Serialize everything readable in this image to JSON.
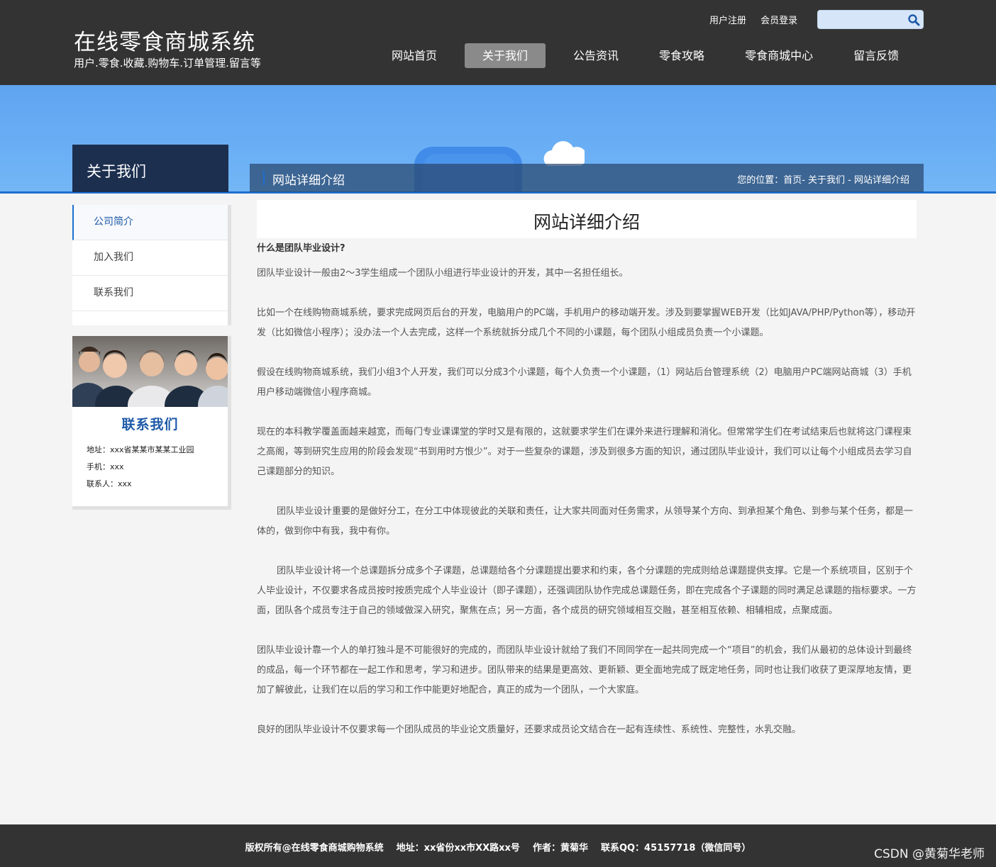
{
  "header": {
    "site_title": "在线零食商城系统",
    "site_subtitle": "用户.零食.收藏.购物车.订单管理.留言等",
    "top_links": [
      "用户注册",
      "会员登录"
    ],
    "search": {
      "placeholder": "",
      "icon": "search-icon"
    },
    "nav": [
      "网站首页",
      "关于我们",
      "公告资讯",
      "零食攻略",
      "零食商城中心",
      "留言反馈"
    ],
    "nav_active": "关于我们"
  },
  "sidebar": {
    "title": "关于我们",
    "items": [
      "公司简介",
      "加入我们",
      "联系我们"
    ],
    "active": "公司简介",
    "contact": {
      "title": "联系我们",
      "address": "地址：xxx省某某市某某工业园",
      "phone": "手机：xxx",
      "person": "联系人：xxx"
    }
  },
  "breadcrumb_bar": {
    "title": "网站详细介绍",
    "label": "您的位置：",
    "path": "首页- 关于我们 - 网站详细介绍"
  },
  "article": {
    "title": "网站详细介绍",
    "question": "什么是团队毕业设计?",
    "paragraphs": [
      "团队毕业设计一般由2～3学生组成一个团队小组进行毕业设计的开发，其中一名担任组长。",
      "",
      "比如一个在线购物商城系统，要求完成网页后台的开发，电脑用户的PC端，手机用户的移动端开发。涉及到要掌握WEB开发（比如JAVA/PHP/Python等），移动开发（比如微信小程序）；没办法一个人去完成，这样一个系统就拆分成几个不同的小课题，每个团队小组成员负责一个小课题。",
      "",
      "假设在线购物商城系统，我们小组3个人开发，我们可以分成3个小课题，每个人负责一个小课题，（1）网站后台管理系统（2）电脑用户PC端网站商城（3）手机用户移动端微信小程序商城。",
      "",
      "现在的本科教学覆盖面越来越宽，而每门专业课课堂的学时又是有限的，这就要求学生们在课外来进行理解和消化。但常常学生们在考试结束后也就将这门课程束之高阁，等到研究生应用的阶段会发现“书到用时方恨少”。对于一些复杂的课题，涉及到很多方面的知识，通过团队毕业设计，我们可以让每个小组成员去学习自己课题部分的知识。",
      "",
      "团队毕业设计重要的是做好分工，在分工中体现彼此的关联和责任，让大家共同面对任务需求，从领导某个方向、到承担某个角色、到参与某个任务，都是一体的，做到你中有我，我中有你。",
      "",
      "团队毕业设计将一个总课题拆分成多个子课题，总课题给各个分课题提出要求和约束，各个分课题的完成则给总课题提供支撑。它是一个系统项目，区别于个人毕业设计，不仅要求各成员按时按质完成个人毕业设计（即子课题），还强调团队协作完成总课题任务，即在完成各个子课题的同时满足总课题的指标要求。一方面，团队各个成员专注于自己的领域做深入研究，聚焦在点；另一方面，各个成员的研究领域相互交融，甚至相互依赖、相辅相成，点聚成面。",
      "",
      "团队毕业设计靠一个人的单打独斗是不可能很好的完成的，而团队毕业设计就给了我们不同同学在一起共同完成一个“项目”的机会，我们从最初的总体设计到最终的成品，每一个环节都在一起工作和思考，学习和进步。团队带来的结果是更高效、更新颖、更全面地完成了既定地任务，同时也让我们收获了更深厚地友情，更加了解彼此，让我们在以后的学习和工作中能更好地配合，真正的成为一个团队，一个大家庭。",
      "",
      "良好的团队毕业设计不仅要求每一个团队成员的毕业论文质量好，还要求成员论文结合在一起有连续性、系统性、完整性，水乳交融。"
    ]
  },
  "footer": {
    "copyright": "版权所有@在线零食商城购物系统",
    "address": "地址：xx省份xx市XX路xx号",
    "author": "作者：黄菊华",
    "qq": "联系QQ：45157718（微信同号）"
  },
  "watermark": "CSDN @黄菊华老师",
  "colors": {
    "header_bg": "#333333",
    "accent": "#1e6fd0",
    "banner": "#6aaff5",
    "nav_active": "#8a8a8a",
    "contact_title": "#1e5aa8"
  }
}
